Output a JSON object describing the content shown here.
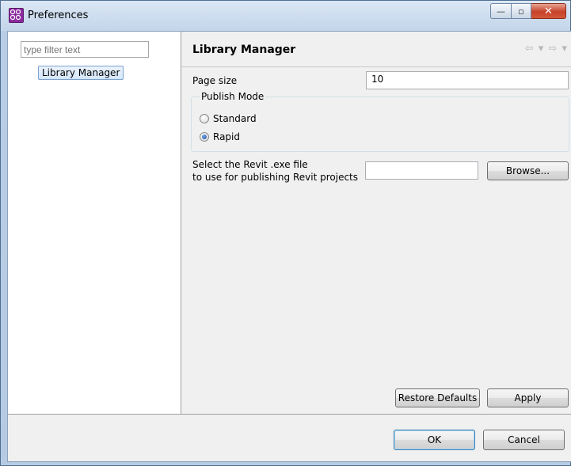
{
  "window": {
    "title": "Preferences",
    "controls": {
      "minimize": "—",
      "maximize": "▫",
      "close": "✕"
    }
  },
  "sidebar": {
    "filter_placeholder": "type filter text",
    "items": [
      {
        "label": "Library Manager",
        "selected": true
      }
    ]
  },
  "page": {
    "title": "Library Manager",
    "nav": {
      "back": "⇦ ▾",
      "forward": "⇨ ▾"
    },
    "page_size": {
      "label": "Page size",
      "value": "10"
    },
    "publish_mode": {
      "title": "Publish Mode",
      "options": [
        {
          "label": "Standard",
          "checked": false
        },
        {
          "label": "Rapid",
          "checked": true
        }
      ]
    },
    "revit": {
      "label_line1": "Select the Revit .exe file",
      "label_line2": "to use for publishing Revit projects",
      "value": "",
      "browse_label": "Browse..."
    },
    "restore_defaults_label": "Restore Defaults",
    "apply_label": "Apply"
  },
  "footer": {
    "ok_label": "OK",
    "cancel_label": "Cancel"
  },
  "icons": {
    "app": "preferences-app-icon",
    "back": "back-arrow-icon",
    "forward": "forward-arrow-icon"
  },
  "colors": {
    "accent": "#3c7fb1",
    "close_button": "#c7422a",
    "app_icon": "#8a2b9e"
  }
}
